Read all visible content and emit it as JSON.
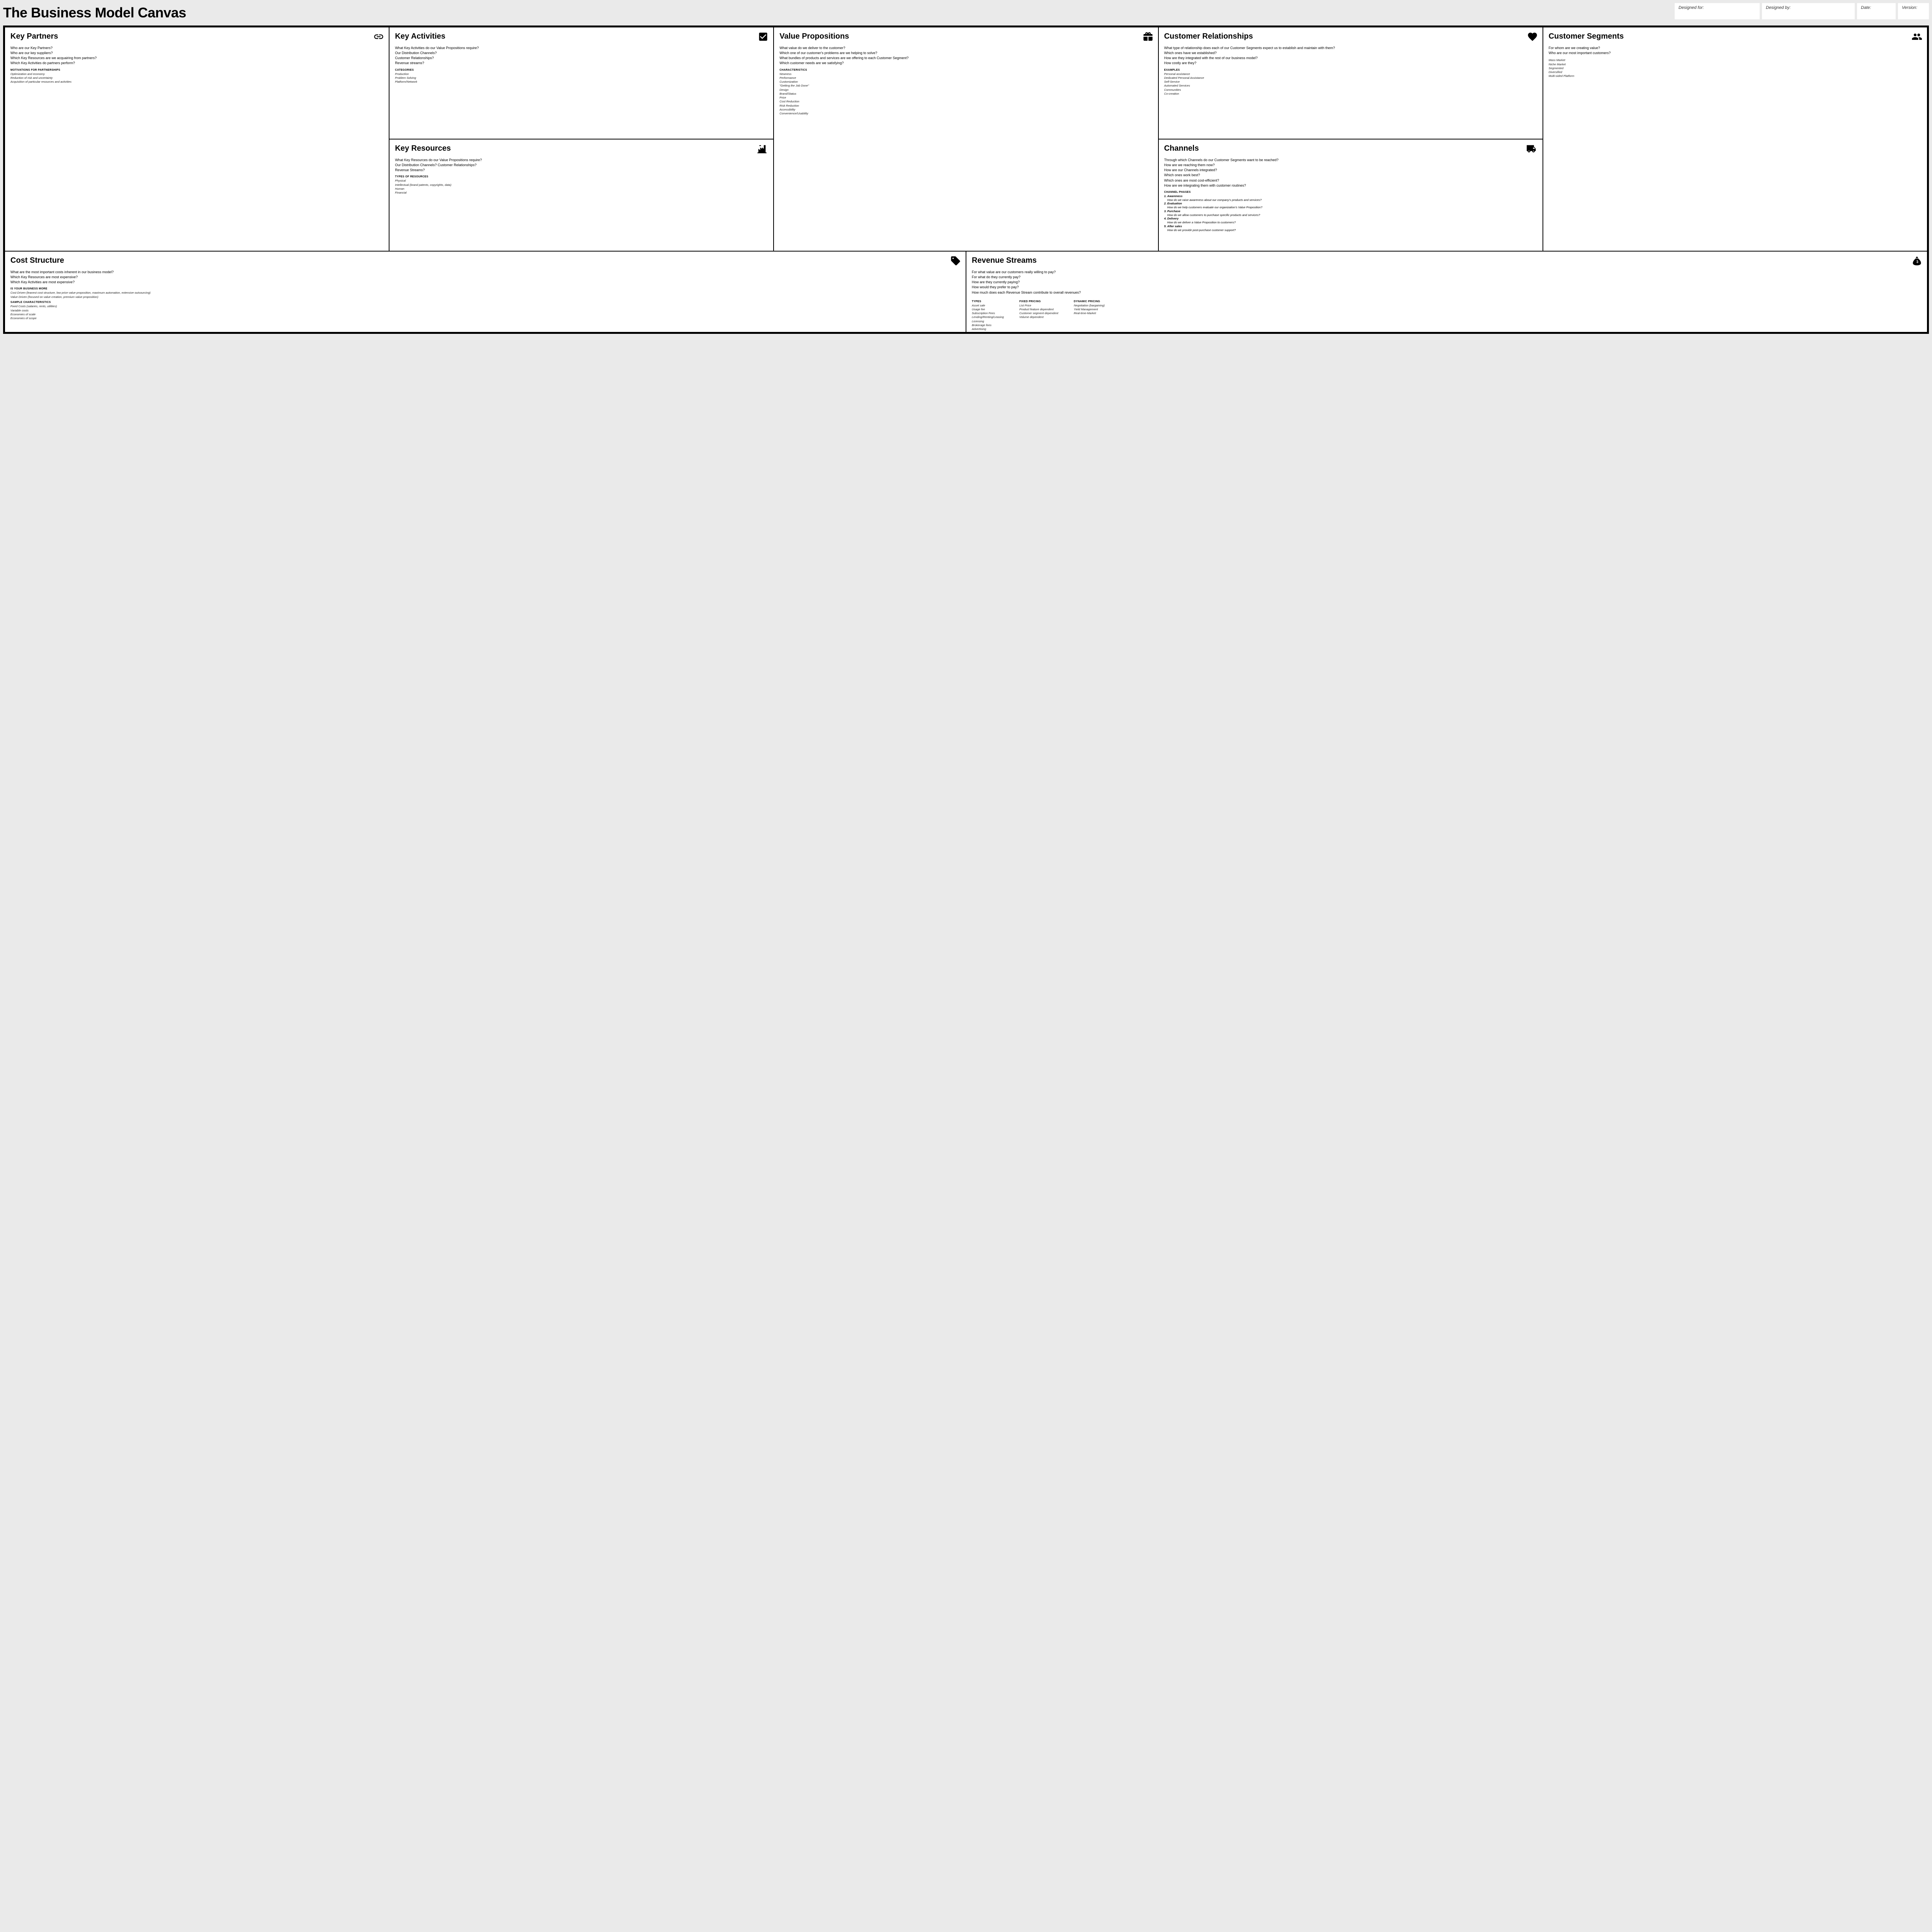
{
  "title": "The Business Model Canvas",
  "meta": {
    "designed_for_label": "Designed for:",
    "designed_by_label": "Designed by:",
    "date_label": "Date:",
    "version_label": "Version:"
  },
  "kp": {
    "title": "Key Partners",
    "questions": [
      "Who are our Key Partners?",
      "Who are our key suppliers?",
      "Which Key Resources are we acquairing from partners?",
      "Which Key Activities do partners perform?"
    ],
    "subhead": "motivations for partnerships",
    "items": [
      "Optimization and economy",
      "Reduction of risk and uncertainty",
      "Acquisition of particular resources and activities"
    ]
  },
  "ka": {
    "title": "Key Activities",
    "questions": [
      "What Key Activities do our Value Propositions require?",
      "Our Distribution Channels?",
      "Customer Relationships?",
      "Revenue streams?"
    ],
    "subhead": "categories",
    "items": [
      "Production",
      "Problem Solving",
      "Platform/Network"
    ]
  },
  "vp": {
    "title": "Value Propositions",
    "questions": [
      "What value do we deliver to the customer?",
      "Which one of our customer's problems are we helping to solve?",
      "What bundles of products and services are we offering to each Customer Segment?",
      "Which customer needs are we satisfying?"
    ],
    "subhead": "characteristics",
    "items": [
      "Newness",
      "Performance",
      "Customization",
      "\"Getting the Job Done\"",
      "Design",
      "Brand/Status",
      "Price",
      "Cost Reduction",
      "Risk Reduction",
      "Accessibility",
      "Convenience/Usability"
    ]
  },
  "cr": {
    "title": "Customer Relationships",
    "questions": [
      "What type of relationship does each of our Customer Segments expect us to establish and maintain with them?",
      "Which ones have we established?",
      "How are they integrated with the rest of our business model?",
      "How costly are they?"
    ],
    "subhead": "examples",
    "items": [
      "Personal assistance",
      "Dedicated Personal Assistance",
      "Self-Service",
      "Automated Services",
      "Communities",
      "Co-creation"
    ]
  },
  "cs": {
    "title": "Customer Segments",
    "questions": [
      "For whom are we creating value?",
      "Who are our most important customers?"
    ],
    "items": [
      "Mass Market",
      "Niche Market",
      "Segmented",
      "Diversified",
      "Multi-sided Platform"
    ]
  },
  "kr": {
    "title": "Key Resources",
    "questions": [
      "What Key Resources do our Value Propositions require?",
      "Our Distribution Channels? Customer Relationships?",
      "Revenue Streams?"
    ],
    "subhead": "types of resources",
    "items": [
      "Physical",
      "Intellectual (brand patents, copyrights, data)",
      "Human",
      "Financial"
    ]
  },
  "ch": {
    "title": "Channels",
    "questions": [
      "Through which Channels do our Customer Segments want to be reached?",
      "How are we reaching them now?",
      "How are our Channels integrated?",
      "Which ones work best?",
      "Which ones are most cost-efficient?",
      "How are we integrating them with customer routines?"
    ],
    "subhead": "channel phases",
    "phases": [
      {
        "n": "1.",
        "name": "Awareness",
        "q": "How do we raise awareness about our company's products and services?"
      },
      {
        "n": "2.",
        "name": "Evaluation",
        "q": "How do we help customers evaluate our organization's Value Proposition?"
      },
      {
        "n": "3.",
        "name": "Purchase",
        "q": "How do we allow customers to purchase specific products and services?"
      },
      {
        "n": "4.",
        "name": "Delivery",
        "q": "How do we deliver a Value Proposition to customers?"
      },
      {
        "n": "5.",
        "name": "After sales",
        "q": "How do we provide post-purchase customer support?"
      }
    ]
  },
  "co": {
    "title": "Cost Structure",
    "questions": [
      "What are the most important costs inherent in our business model?",
      "Which Key Resources are most expensive?",
      "Which Key Activities are most expensive?"
    ],
    "subhead1": "is your business more",
    "items1": [
      "Cost Driven (leanest cost structure, low price value proposition, maximum automation, extensive outsourcing)",
      "Value Driven (focused on value creation, premium value proposition)"
    ],
    "subhead2": "sample characteristics",
    "items2": [
      "Fixed Costs (salaries, rents, utilities)",
      "Variable costs",
      "Economies of scale",
      "Economies of scope"
    ]
  },
  "rs": {
    "title": "Revenue Streams",
    "questions": [
      "For what value are our customers really willing to pay?",
      "For what do they currently pay?",
      "How are they currently paying?",
      "How would they prefer to pay?",
      "How much does each Revenue Stream contribute to overall revenues?"
    ],
    "col1_head": "types",
    "col1": [
      "Asset sale",
      "Usage fee",
      "Subscription Fees",
      "Lending/Renting/Leasing",
      "Licensing",
      "Brokerage fees",
      "Advertising"
    ],
    "col2_head": "fixed pricing",
    "col2": [
      "List Price",
      "Product feature dependent",
      "Customer segment dependent",
      "Volume dependent"
    ],
    "col3_head": "dynamic pricing",
    "col3": [
      "Negotiation (bargaining)",
      "Yield Management",
      "Real-time-Market"
    ]
  }
}
